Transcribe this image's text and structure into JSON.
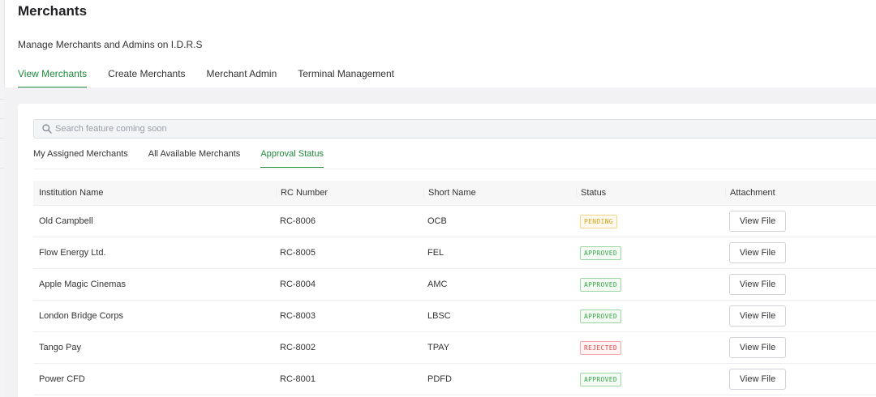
{
  "header": {
    "title": "Merchants",
    "subtitle": "Manage Merchants and Admins on I.D.R.S"
  },
  "main_tabs": [
    {
      "label": "View Merchants",
      "active": true
    },
    {
      "label": "Create Merchants",
      "active": false
    },
    {
      "label": "Merchant Admin",
      "active": false
    },
    {
      "label": "Terminal Management",
      "active": false
    }
  ],
  "search": {
    "placeholder": "Search feature coming soon",
    "icon": "search-icon"
  },
  "sub_tabs": [
    {
      "label": "My Assigned Merchants",
      "active": false
    },
    {
      "label": "All Available Merchants",
      "active": false
    },
    {
      "label": "Approval Status",
      "active": true
    }
  ],
  "table": {
    "columns": [
      "Institution Name",
      "RC Number",
      "Short Name",
      "Status",
      "Attachment"
    ],
    "rows": [
      {
        "institution": "Old Campbell",
        "rc": "RC-8006",
        "short": "OCB",
        "status": "PENDING",
        "status_kind": "pending",
        "attachment": "View File"
      },
      {
        "institution": "Flow Energy Ltd.",
        "rc": "RC-8005",
        "short": "FEL",
        "status": "APPROVED",
        "status_kind": "approved",
        "attachment": "View File"
      },
      {
        "institution": "Apple Magic Cinemas",
        "rc": "RC-8004",
        "short": "AMC",
        "status": "APPROVED",
        "status_kind": "approved",
        "attachment": "View File"
      },
      {
        "institution": "London Bridge Corps",
        "rc": "RC-8003",
        "short": "LBSC",
        "status": "APPROVED",
        "status_kind": "approved",
        "attachment": "View File"
      },
      {
        "institution": "Tango Pay",
        "rc": "RC-8002",
        "short": "TPAY",
        "status": "REJECTED",
        "status_kind": "rejected",
        "attachment": "View File"
      },
      {
        "institution": "Power CFD",
        "rc": "RC-8001",
        "short": "PDFD",
        "status": "APPROVED",
        "status_kind": "approved",
        "attachment": "View File"
      }
    ]
  },
  "colors": {
    "accent": "#1f8a3c",
    "pending": "#d4a017",
    "approved": "#3aa64a",
    "rejected": "#e0484d"
  }
}
